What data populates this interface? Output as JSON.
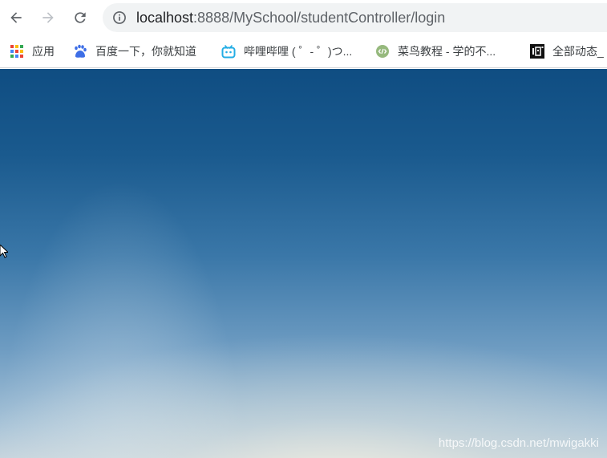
{
  "toolbar": {
    "back_icon": "arrow-left-icon",
    "forward_icon": "arrow-right-icon",
    "reload_icon": "reload-icon",
    "site_info_icon": "info-icon"
  },
  "omnibox": {
    "host": "localhost",
    "path": ":8888/MySchool/studentController/login"
  },
  "bookmarks": [
    {
      "label": "应用",
      "icon": "apps-grid-icon"
    },
    {
      "label": "百度一下，你就知道",
      "icon": "baidu-icon"
    },
    {
      "label": "哔哩哔哩 ( ゜- ゜)つ...",
      "icon": "bilibili-icon"
    },
    {
      "label": "菜鸟教程 - 学的不...",
      "icon": "runoob-icon"
    },
    {
      "label": "全部动态_",
      "icon": "hot-icon"
    }
  ],
  "watermark": "https://blog.csdn.net/mwigakki",
  "colors": {
    "sky_top": "#0f4d82",
    "sky_bottom": "#c4d3dd",
    "omnibox_bg": "#f1f3f4"
  }
}
